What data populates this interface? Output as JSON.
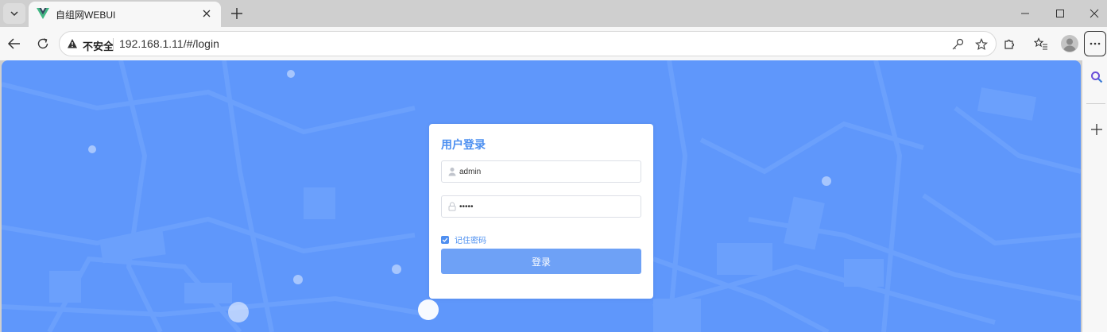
{
  "browser": {
    "tab": {
      "title": "自组网WEBUI",
      "logo_icon": "vue-logo-icon"
    },
    "address_bar": {
      "security_label": "不安全",
      "url": "192.168.1.11/#/login"
    }
  },
  "login": {
    "title": "用户登录",
    "username": {
      "value": "admin",
      "placeholder": ""
    },
    "password": {
      "value": "12345",
      "placeholder": ""
    },
    "remember": {
      "label": "记住密码",
      "checked": true
    },
    "submit_label": "登录"
  },
  "colors": {
    "page_background": "#5f97fb",
    "accent": "#4c8ff0",
    "button": "#6ea1f6"
  }
}
